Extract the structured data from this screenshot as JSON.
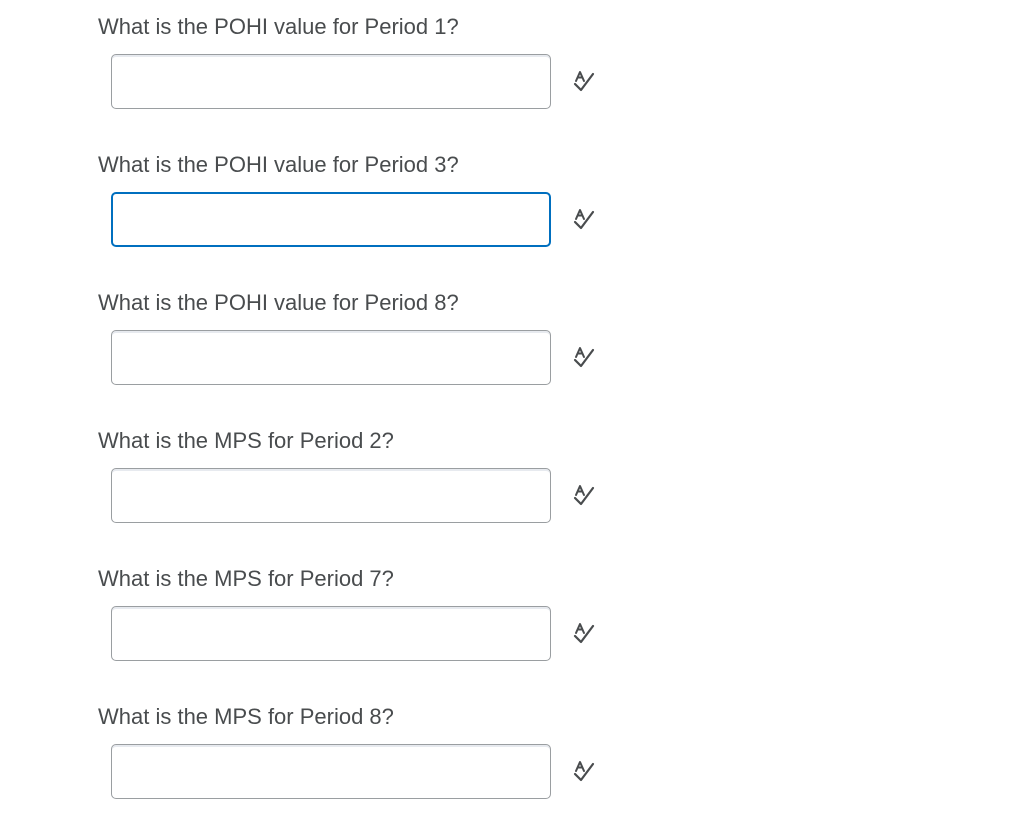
{
  "questions": [
    {
      "label": "What is the POHI value for Period 1?",
      "value": "",
      "focused": false
    },
    {
      "label": "What is the POHI value for Period 3?",
      "value": "",
      "focused": true
    },
    {
      "label": "What is the POHI value for Period 8?",
      "value": "",
      "focused": false
    },
    {
      "label": "What is the MPS for Period 2?",
      "value": "",
      "focused": false
    },
    {
      "label": "What is the MPS for Period 7?",
      "value": "",
      "focused": false
    },
    {
      "label": "What is the MPS for Period 8?",
      "value": "",
      "focused": false
    }
  ],
  "icons": {
    "spell_check": "spell-check-icon"
  },
  "colors": {
    "text": "#494c4e",
    "input_border": "#9a9ea1",
    "focus_border": "#006fbf"
  }
}
